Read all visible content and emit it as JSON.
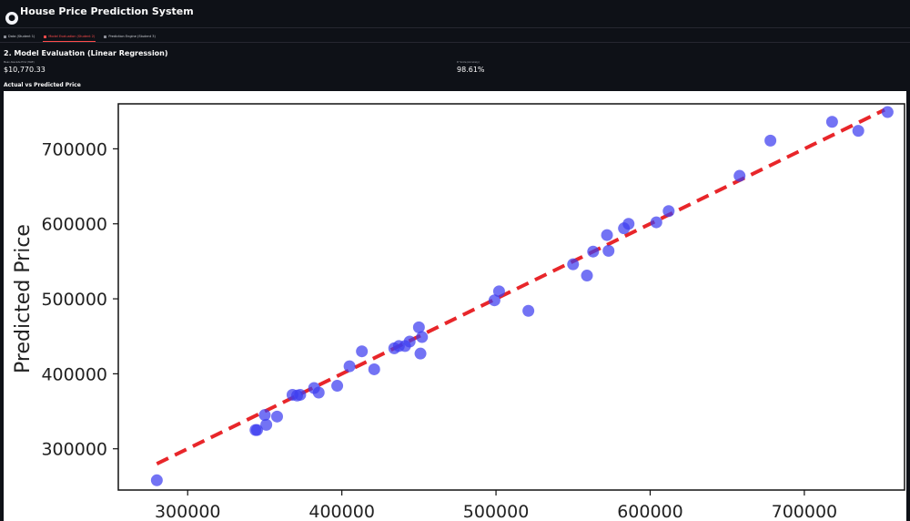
{
  "app": {
    "logo_icon": "brain-icon",
    "title": "House Price Prediction System"
  },
  "tabs": [
    {
      "label": "Data (Student 1)",
      "active": false
    },
    {
      "label": "Model Evaluation (Student 2)",
      "active": true
    },
    {
      "label": "Prediction Engine (Student 3)",
      "active": false
    }
  ],
  "section": {
    "title": "2. Model Evaluation (Linear Regression)"
  },
  "metrics": [
    {
      "label": "Mean Absolute Error (MAE)",
      "value": "$10,770.33"
    },
    {
      "label": "R² Score (Accuracy)",
      "value": "98.61%"
    }
  ],
  "plot_header": "Actual vs Predicted Price",
  "colors": {
    "background": "#0e1117",
    "accent": "#ff4b4b",
    "points": "#3d3df0",
    "fit_line": "#e8262a"
  },
  "chart_data": {
    "type": "scatter",
    "xlabel": "",
    "ylabel": "Predicted Price",
    "x_ticks": [
      300000,
      400000,
      500000,
      600000,
      700000
    ],
    "y_ticks": [
      300000,
      400000,
      500000,
      600000,
      700000
    ],
    "xlim": [
      255000,
      765000
    ],
    "ylim": [
      245000,
      760000
    ],
    "reference_line": {
      "style": "dashed",
      "from": [
        280000,
        280000
      ],
      "to": [
        752000,
        752000
      ]
    },
    "points": [
      {
        "x": 280000,
        "y": 258000
      },
      {
        "x": 344000,
        "y": 325000
      },
      {
        "x": 345000,
        "y": 325000
      },
      {
        "x": 350000,
        "y": 345000
      },
      {
        "x": 351000,
        "y": 332000
      },
      {
        "x": 358000,
        "y": 343000
      },
      {
        "x": 368000,
        "y": 372000
      },
      {
        "x": 371000,
        "y": 371000
      },
      {
        "x": 373000,
        "y": 372000
      },
      {
        "x": 382000,
        "y": 381000
      },
      {
        "x": 385000,
        "y": 375000
      },
      {
        "x": 397000,
        "y": 384000
      },
      {
        "x": 405000,
        "y": 410000
      },
      {
        "x": 413000,
        "y": 430000
      },
      {
        "x": 421000,
        "y": 406000
      },
      {
        "x": 434000,
        "y": 434000
      },
      {
        "x": 437000,
        "y": 437000
      },
      {
        "x": 441000,
        "y": 437000
      },
      {
        "x": 444000,
        "y": 443000
      },
      {
        "x": 450000,
        "y": 462000
      },
      {
        "x": 451000,
        "y": 427000
      },
      {
        "x": 452000,
        "y": 449000
      },
      {
        "x": 499000,
        "y": 498000
      },
      {
        "x": 502000,
        "y": 510000
      },
      {
        "x": 521000,
        "y": 484000
      },
      {
        "x": 550000,
        "y": 546000
      },
      {
        "x": 559000,
        "y": 531000
      },
      {
        "x": 563000,
        "y": 563000
      },
      {
        "x": 572000,
        "y": 585000
      },
      {
        "x": 573000,
        "y": 564000
      },
      {
        "x": 583000,
        "y": 594000
      },
      {
        "x": 586000,
        "y": 600000
      },
      {
        "x": 604000,
        "y": 602000
      },
      {
        "x": 612000,
        "y": 617000
      },
      {
        "x": 658000,
        "y": 664000
      },
      {
        "x": 678000,
        "y": 711000
      },
      {
        "x": 718000,
        "y": 736000
      },
      {
        "x": 735000,
        "y": 724000
      },
      {
        "x": 754000,
        "y": 749000
      }
    ]
  }
}
